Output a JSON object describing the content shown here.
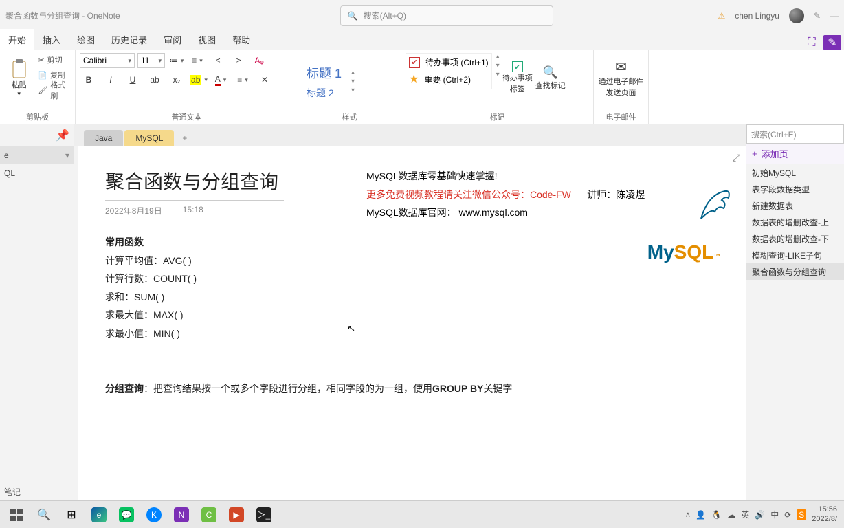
{
  "titlebar": {
    "title": "聚合函数与分组查询  -  OneNote",
    "search_placeholder": "搜索(Alt+Q)",
    "user_name": "chen Lingyu"
  },
  "menu": {
    "items": [
      "开始",
      "插入",
      "绘图",
      "历史记录",
      "审阅",
      "视图",
      "帮助"
    ]
  },
  "ribbon": {
    "clipboard": {
      "cut": "剪切",
      "copy": "复制",
      "fmtpaint": "格式刷",
      "paste": "粘贴",
      "label": "剪贴板"
    },
    "font": {
      "name": "Calibri",
      "size": "11",
      "label": "普通文本"
    },
    "styles": {
      "h1": "标题 1",
      "h2": "标题 2",
      "label": "样式"
    },
    "tags": {
      "todo": "待办事项 (Ctrl+1)",
      "important": "重要 (Ctrl+2)",
      "todotag": "待办事项标签",
      "find": "查找标记",
      "label": "标记"
    },
    "email": {
      "btn": "通过电子邮件发送页面",
      "label": "电子邮件"
    }
  },
  "leftnav": {
    "notebook": "e",
    "section": "QL",
    "notes": "笔记"
  },
  "tabs": {
    "java": "Java",
    "mysql": "MySQL"
  },
  "page": {
    "title": "聚合函数与分组查询",
    "date": "2022年8月19日",
    "time": "15:18",
    "section_heading": "常用函数",
    "lines": [
      "计算平均值：AVG( )",
      "计算行数：COUNT( )",
      "求和：SUM( )",
      "求最大值：MAX( )",
      "求最小值：MIN( )"
    ],
    "group_label": "分组查询",
    "group_text": "：把查询结果按一个或多个字段进行分组，相同字段的为一组，使用",
    "group_kw": "GROUP BY",
    "group_tail": "关键字",
    "info1": "MySQL数据库零基础快速掌握!",
    "info2": "更多免费视频教程请关注微信公众号：Code-FW",
    "teacher_label": "讲师：",
    "teacher": "陈凌煜",
    "info3": "MySQL数据库官网：  www.mysql.com"
  },
  "rightcol": {
    "search": "搜索(Ctrl+E)",
    "add": "添加页",
    "pages": [
      "初始MySQL",
      "表字段数据类型",
      "新建数据表",
      "数据表的增删改查-上",
      "数据表的增删改查-下",
      "模糊查询-LIKE子句",
      "聚合函数与分组查询"
    ]
  },
  "taskbar": {
    "time": "15:56",
    "date": "2022/8/"
  }
}
